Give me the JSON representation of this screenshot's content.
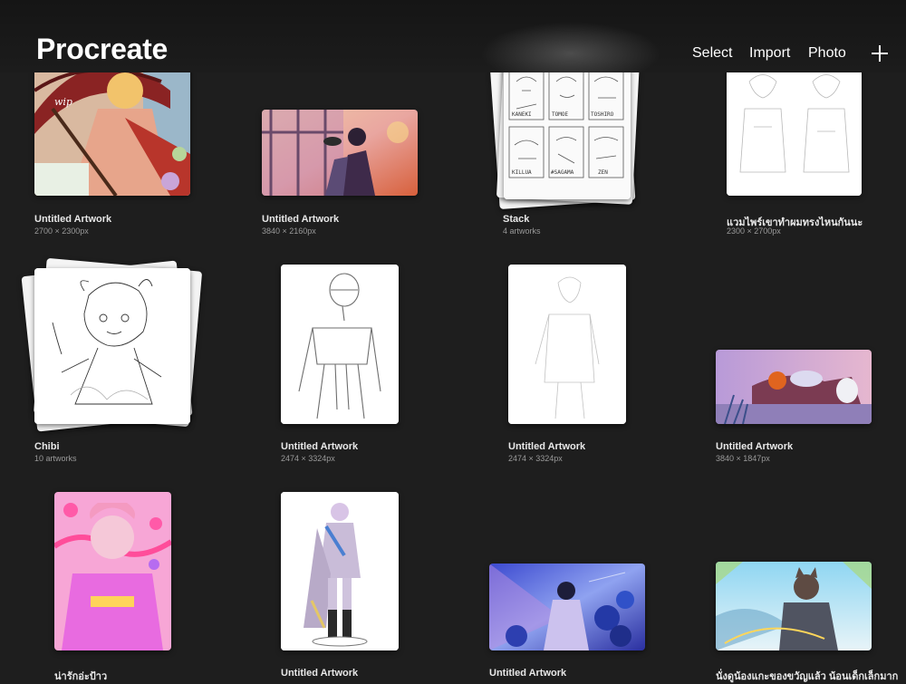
{
  "header": {
    "brand": "Procreate",
    "select_label": "Select",
    "import_label": "Import",
    "photo_label": "Photo",
    "add_icon": "plus-icon"
  },
  "gallery": {
    "items": [
      {
        "title": "Untitled Artwork",
        "subtitle": "2700 × 2300px",
        "kind": "artwork"
      },
      {
        "title": "Untitled Artwork",
        "subtitle": "3840 × 2160px",
        "kind": "artwork"
      },
      {
        "title": "Stack",
        "subtitle": "4 artworks",
        "kind": "stack",
        "sheet_labels": [
          "KANEKI",
          "TOMOE",
          "TOSHIRO",
          "KILLUA",
          "#SAGAMA",
          "ZEN"
        ]
      },
      {
        "title": "แวมไพร์เขาทำผมทรงไหนกันนะ",
        "subtitle": "2300 × 2700px",
        "kind": "artwork"
      },
      {
        "title": "Chibi",
        "subtitle": "10 artworks",
        "kind": "stack"
      },
      {
        "title": "Untitled Artwork",
        "subtitle": "2474 × 3324px",
        "kind": "artwork"
      },
      {
        "title": "Untitled Artwork",
        "subtitle": "2474 × 3324px",
        "kind": "artwork"
      },
      {
        "title": "Untitled Artwork",
        "subtitle": "3840 × 1847px",
        "kind": "artwork"
      },
      {
        "title": "น่ารักอ่ะป้าว",
        "subtitle": "",
        "kind": "artwork"
      },
      {
        "title": "Untitled Artwork",
        "subtitle": "",
        "kind": "artwork"
      },
      {
        "title": "Untitled Artwork",
        "subtitle": "",
        "kind": "artwork"
      },
      {
        "title": "นั่งดูน้องแกะของขวัญแล้ว น้อนเด็กเล็กมาก",
        "subtitle": "",
        "kind": "artwork"
      }
    ]
  },
  "colors": {
    "background": "#1e1e1e",
    "header": "#171717",
    "text": "#ffffff",
    "subtitle": "#9a9a9a"
  }
}
